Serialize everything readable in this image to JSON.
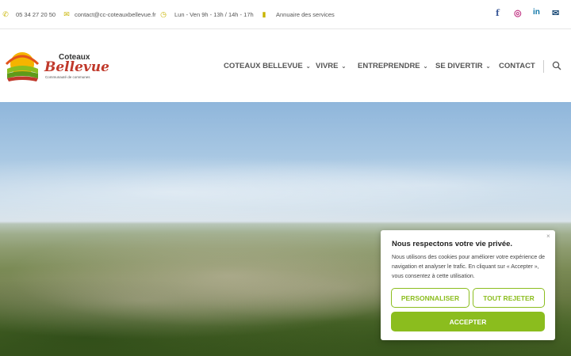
{
  "topbar": {
    "phone": "05 34 27 20 50",
    "email": "contact@cc-coteauxbellevue.fr",
    "hours": "Lun - Ven 9h - 13h / 14h - 17h",
    "directory": "Annuaire des services",
    "icons": [
      "phone-icon",
      "mail-icon",
      "clock-icon",
      "book-icon"
    ],
    "social": {
      "facebook": "f",
      "instagram": "◎",
      "linkedin": "in",
      "mail": "✉"
    }
  },
  "logo": {
    "line1": "Coteaux",
    "line2": "Bellevue",
    "line3": "Communauté de communes"
  },
  "nav": {
    "items": [
      {
        "label": "COTEAUX BELLEVUE",
        "has_dropdown": true
      },
      {
        "label": "VIVRE",
        "has_dropdown": true
      },
      {
        "label": "ENTREPRENDRE",
        "has_dropdown": true
      },
      {
        "label": "SE DIVERTIR",
        "has_dropdown": true
      },
      {
        "label": "CONTACT",
        "has_dropdown": false
      }
    ]
  },
  "cookie": {
    "title": "Nous respectons votre vie privée.",
    "text": "Nous utilisons des cookies pour améliorer votre expérience de navigation et analyser le trafic. En cliquant sur « Accepter », vous consentez à cette utilisation.",
    "customize_label": "PERSONNALISER",
    "reject_label": "TOUT REJETER",
    "accept_label": "ACCEPTER",
    "close_glyph": "×"
  },
  "colors": {
    "accent_green": "#8bbd1e",
    "icon_yellow": "#c8b400",
    "logo_red": "#c0392b"
  }
}
